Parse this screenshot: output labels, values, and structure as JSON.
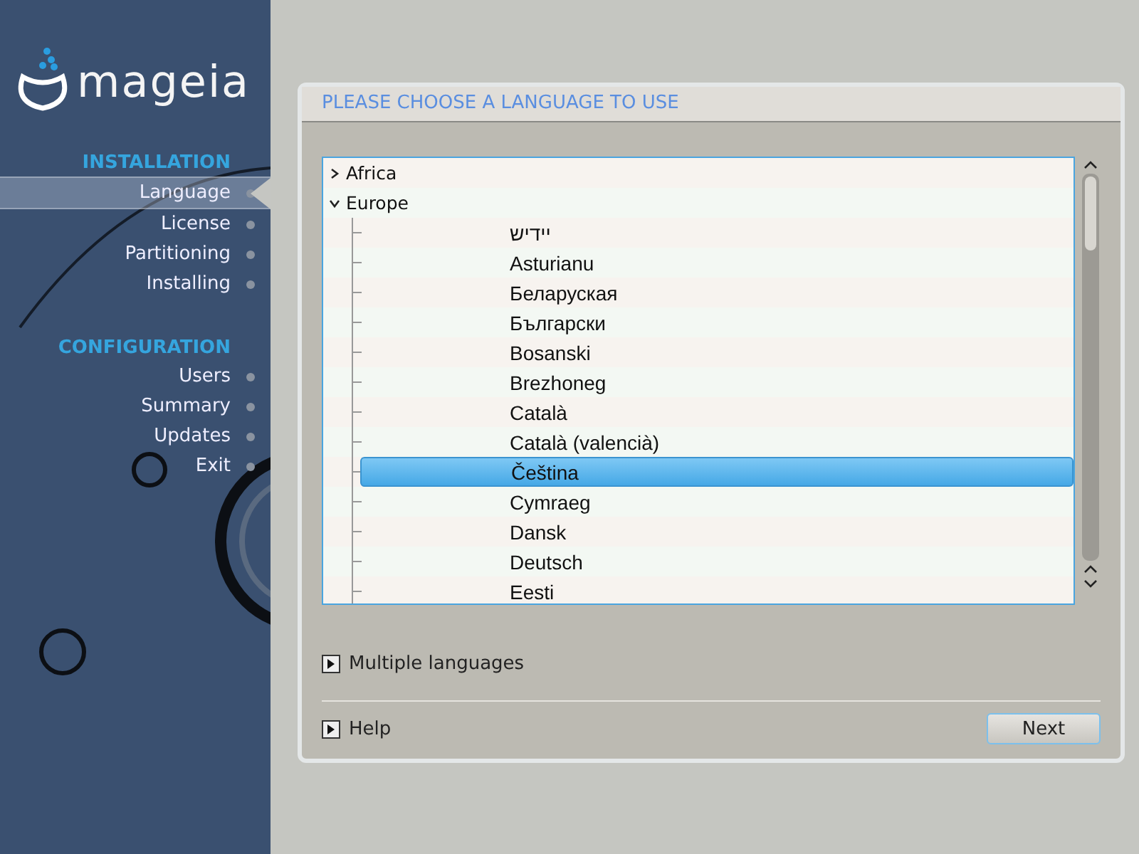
{
  "logo": {
    "text": "mageia"
  },
  "steps": [
    {
      "heading": "INSTALLATION",
      "items": [
        {
          "label": "Language",
          "selected": true
        },
        {
          "label": "License",
          "selected": false
        },
        {
          "label": "Partitioning",
          "selected": false
        },
        {
          "label": "Installing",
          "selected": false
        }
      ]
    },
    {
      "heading": "CONFIGURATION",
      "items": [
        {
          "label": "Users",
          "selected": false
        },
        {
          "label": "Summary",
          "selected": false
        },
        {
          "label": "Updates",
          "selected": false
        },
        {
          "label": "Exit",
          "selected": false
        }
      ]
    }
  ],
  "panel": {
    "title": "PLEASE CHOOSE A LANGUAGE TO USE"
  },
  "tree": [
    {
      "label": "Africa",
      "expanded": false
    },
    {
      "label": "Europe",
      "expanded": true,
      "children": [
        {
          "label": "יידיש",
          "selected": false
        },
        {
          "label": "Asturianu",
          "selected": false
        },
        {
          "label": "Беларуская",
          "selected": false
        },
        {
          "label": "Български",
          "selected": false
        },
        {
          "label": "Bosanski",
          "selected": false
        },
        {
          "label": "Brezhoneg",
          "selected": false
        },
        {
          "label": "Català",
          "selected": false
        },
        {
          "label": "Català (valencià)",
          "selected": false
        },
        {
          "label": "Čeština",
          "selected": true
        },
        {
          "label": "Cymraeg",
          "selected": false
        },
        {
          "label": "Dansk",
          "selected": false
        },
        {
          "label": "Deutsch",
          "selected": false
        },
        {
          "label": "Eesti",
          "selected": false
        }
      ]
    }
  ],
  "multiple_languages": {
    "label": "Multiple languages"
  },
  "help": {
    "label": "Help"
  },
  "buttons": [
    "Next"
  ]
}
